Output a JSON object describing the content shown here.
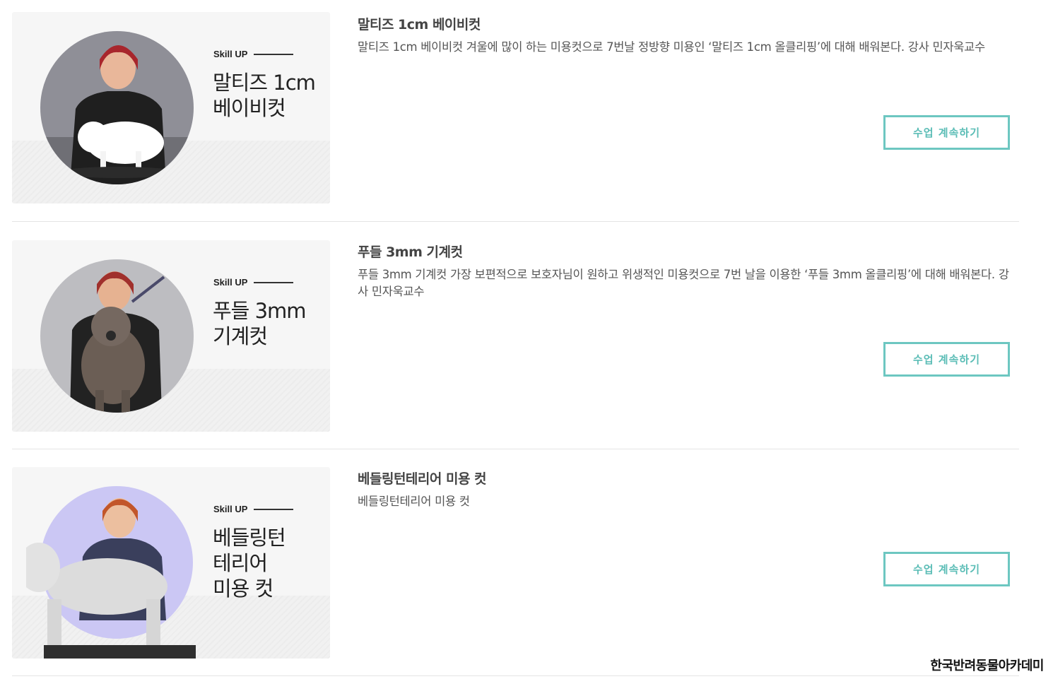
{
  "courses": [
    {
      "badge": "Skill UP",
      "thumb_title": "말티즈 1cm\n베이비컷",
      "title": "말티즈 1cm 베이비컷",
      "description": "말티즈 1cm 베이비컷 겨울에 많이 하는 미용컷으로 7번날 정방향 미용인 ‘말티즈 1cm 올클리핑’에 대해 배워본다. 강사 민자욱교수",
      "button": "수업 계속하기",
      "circle_color": "#8e8e96"
    },
    {
      "badge": "Skill UP",
      "thumb_title": "푸들 3mm\n기계컷",
      "title": "푸들 3mm 기계컷",
      "description": "푸들 3mm 기계컷 가장 보편적으로 보호자님이 원하고 위생적인 미용컷으로 7번 날을 이용한 ‘푸들 3mm 올클리핑’에 대해 배워본다. 강사 민자욱교수",
      "button": "수업 계속하기",
      "circle_color": "#b9b9bd"
    },
    {
      "badge": "Skill UP",
      "thumb_title": "베들링턴\n테리어\n미용 컷",
      "title": "베들링턴테리어 미용 컷",
      "description": "베들링턴테리어 미용 컷",
      "button": "수업 계속하기",
      "circle_color": "#c9c6f3"
    }
  ],
  "footer": {
    "brand": "한국반려동물아카데미"
  }
}
